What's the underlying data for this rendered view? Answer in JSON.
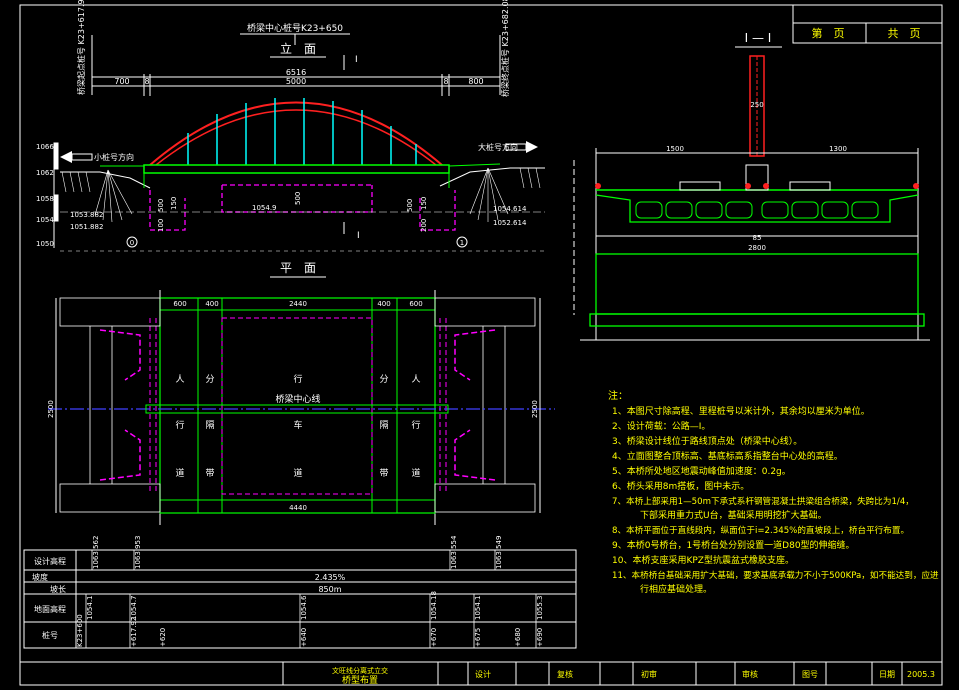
{
  "header": {
    "page_label": "第　页",
    "total_label": "共　页"
  },
  "elevation": {
    "center_stake": "桥梁中心桩号K23+650",
    "title": "立　面",
    "section_mark": "I",
    "left_stake": "桥梁起点桩号\nK23+617.92",
    "right_stake": "桥梁终点桩号\nK23+682.08",
    "dims": {
      "total": "6516",
      "span": "5000",
      "left": "700",
      "left_small": "8",
      "right": "800",
      "right_small": "8"
    },
    "left_dir": "小桩号方向",
    "right_dir": "大桩号方向",
    "elev_scale": [
      "1066",
      "1062",
      "1058",
      "1054",
      "1050"
    ],
    "levels": {
      "center": "1054.9",
      "left_top": "1053.882",
      "left_bot": "1051.882",
      "right_top": "1054.614",
      "right_bot": "1052.614"
    },
    "small_dims": [
      "500",
      "150",
      "500",
      "500",
      "100",
      "150",
      "200"
    ],
    "pier_left": "0",
    "pier_right": "1"
  },
  "plan": {
    "title": "平　面",
    "top_dims": [
      "600",
      "400",
      "2440",
      "400",
      "600"
    ],
    "bottom_dim": "4440",
    "width_left": "2500",
    "width_right": "2500",
    "center_line": "桥梁中心线",
    "row1": [
      "人",
      "分",
      "行",
      "分",
      "人"
    ],
    "row2": [
      "行",
      "隔",
      "车",
      "隔",
      "行"
    ],
    "row3": [
      "道",
      "带",
      "道",
      "带",
      "道"
    ]
  },
  "section": {
    "title": "I — I",
    "dim_center": "250",
    "dim_left": "1500",
    "dim_right": "1300",
    "dim_total": "2800",
    "dim_inner": "85"
  },
  "profile_table": {
    "rows": [
      "设计高程",
      "坡度",
      "坡长",
      "地面高程",
      "桩号"
    ],
    "grade": "2.435%",
    "length": "850m",
    "design_vals": [
      "1063.562",
      "1063.953",
      "1063.554",
      "1063.549"
    ],
    "ground_vals": [
      "1054.1",
      "1054.7",
      "1054.6",
      "1054.18",
      "1054.1",
      "1055.3"
    ],
    "stakes": [
      "K23+600",
      "+617.92",
      "+620",
      "+640",
      "+670",
      "+675",
      "+680",
      "+690"
    ]
  },
  "notes": {
    "title": "注：",
    "items": [
      "1、本图尺寸除高程、里程桩号以米计外，其余均以厘米为单位。",
      "2、设计荷载：公路—I。",
      "3、桥梁设计线位于路线顶点处（桥梁中心线）。",
      "4、立面图整合顶标高、基底标高系指整台中心处的高程。",
      "5、本桥所处地区地震动峰值加速度：0.2g。",
      "6、桥头采用8m搭板，图中未示。",
      "7、本桥上部采用1—50m下承式系杆钢管混凝土拱梁组合桥梁，失跨比为1/4，",
      "下部采用重力式U台，基础采用明挖扩大基础。",
      "8、本桥平面位于直线段内，纵面位于i=2.345%的直坡段上，桥台平行布置。",
      "9、本桥0号桥台，1号桥台处分别设置一道D80型的伸缩缝。",
      "10、本桥支座采用KPZ型抗震盆式橡胶支座。",
      "11、本桥桥台基础采用扩大基础，要求基底承载力不小于500KPa，如不能达到，应进",
      "行相应基础处理。"
    ]
  },
  "title_block": {
    "project": "文旺线分离式立交",
    "drawing": "桥型布置",
    "design": "设计",
    "review": "复核",
    "check": "初审",
    "audit": "审核",
    "drawing_no": "图号",
    "date_label": "日期",
    "date": "2005.3"
  },
  "colors": {
    "frame": "#ffffff",
    "text": "#ffff00",
    "green": "#00ff00",
    "magenta": "#ff00ff",
    "red": "#ff2020",
    "cyan": "#00ffff",
    "blue": "#4040ff"
  }
}
